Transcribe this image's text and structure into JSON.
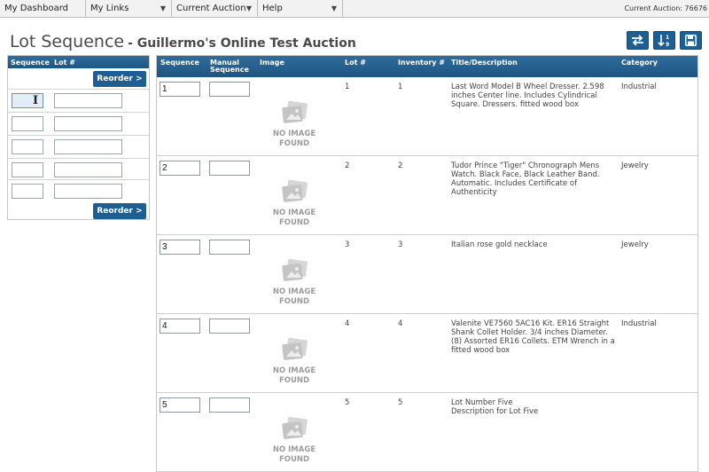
{
  "nav": {
    "items": [
      {
        "label": "My Dashboard",
        "has_menu": false
      },
      {
        "label": "My Links",
        "has_menu": true
      },
      {
        "label": "Current Auction",
        "has_menu": true
      },
      {
        "label": "Help",
        "has_menu": true
      }
    ],
    "current_auction": "Current Auction: 76676"
  },
  "page": {
    "title": "Lot Sequence",
    "subtitle": "- Guillermo's Online Test Auction"
  },
  "toolbar": {
    "icons": [
      "swap-arrows-icon",
      "sort-numeric-icon",
      "save-disk-icon"
    ]
  },
  "left_panel": {
    "headers": {
      "sequence": "Sequence",
      "lot": "Lot #"
    },
    "reorder_label": "Reorder >",
    "rows": [
      {
        "sequence": "",
        "lot": ""
      },
      {
        "sequence": "",
        "lot": ""
      },
      {
        "sequence": "",
        "lot": ""
      },
      {
        "sequence": "",
        "lot": ""
      },
      {
        "sequence": "",
        "lot": ""
      }
    ]
  },
  "table": {
    "headers": {
      "sequence": "Sequence",
      "manual_1": "Manual",
      "manual_2": "Sequence",
      "image": "Image",
      "lot": "Lot #",
      "inventory": "Inventory #",
      "title": "Title/Description",
      "category": "Category"
    },
    "no_image_1": "NO IMAGE",
    "no_image_2": "FOUND",
    "rows": [
      {
        "sequence": "1",
        "manual": "",
        "lot": "1",
        "inventory": "1",
        "title": "Last Word Model B Wheel Dresser. 2.598 inches Center line. Includes Cylindrical Square. Dressers. fitted wood box",
        "category": "Industrial"
      },
      {
        "sequence": "2",
        "manual": "",
        "lot": "2",
        "inventory": "2",
        "title": "Tudor Prince \"Tiger\" Chronograph Mens Watch. Black Face, Black Leather Band. Automatic. Includes Certificate of Authenticity",
        "category": "Jewelry"
      },
      {
        "sequence": "3",
        "manual": "",
        "lot": "3",
        "inventory": "3",
        "title": "Italian rose gold necklace",
        "category": "Jewelry"
      },
      {
        "sequence": "4",
        "manual": "",
        "lot": "4",
        "inventory": "4",
        "title": "Valenite VE7560 5AC16 Kit. ER16 Straight Shank Collet Holder. 3/4 inches Diameter. (8) Assorted ER16 Collets. ETM Wrench in a fitted wood box",
        "category": "Industrial"
      },
      {
        "sequence": "5",
        "manual": "",
        "lot": "5",
        "inventory": "5",
        "title": "Lot Number Five\nDescription for Lot Five",
        "category": ""
      }
    ]
  }
}
